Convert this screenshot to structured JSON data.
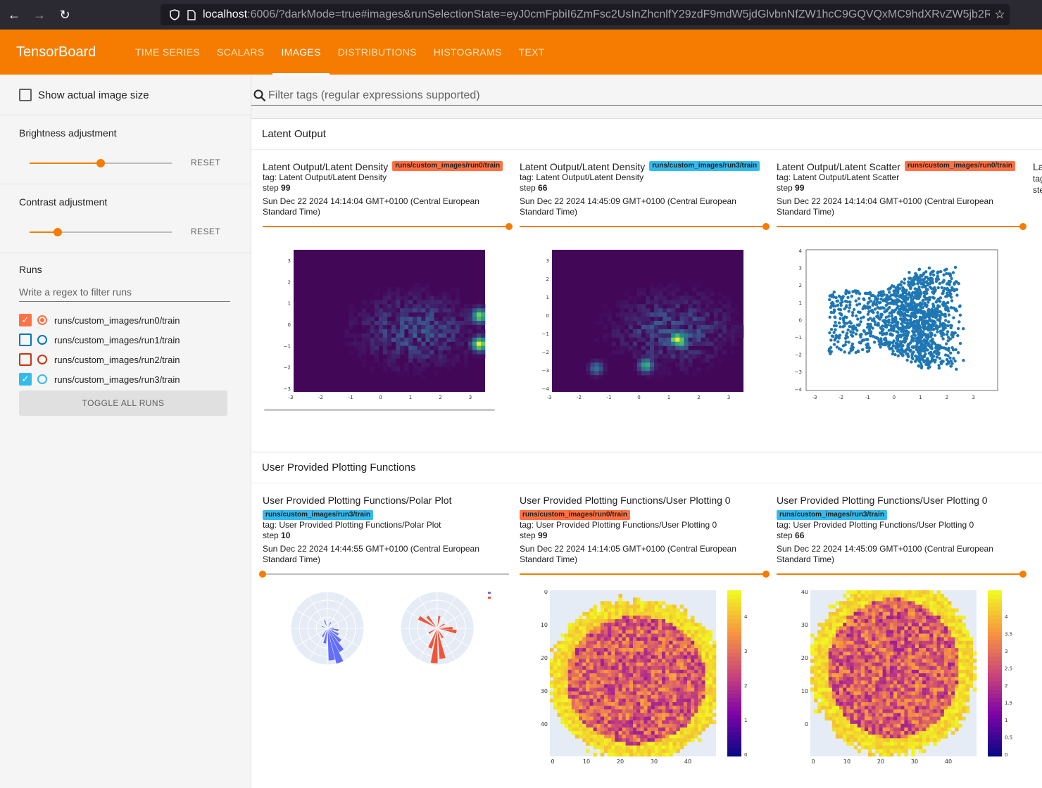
{
  "browser": {
    "url_host": "localhost",
    "url_rest": ":6006/?darkMode=true#images&runSelectionState=eyJ0cmFpbiI6ZmFsc2UsInZhcnlfY29zdF9mdW5jdGlvbnNfZW1hcC9GQVQxMC9hdXRvZW5jb2Rlci9"
  },
  "header": {
    "brand": "TensorBoard",
    "tabs": [
      "TIME SERIES",
      "SCALARS",
      "IMAGES",
      "DISTRIBUTIONS",
      "HISTOGRAMS",
      "TEXT"
    ],
    "active_tab": "IMAGES"
  },
  "sidebar": {
    "show_actual_size": "Show actual image size",
    "brightness": {
      "title": "Brightness adjustment",
      "reset": "RESET",
      "value": 0.5
    },
    "contrast": {
      "title": "Contrast adjustment",
      "reset": "RESET",
      "value": 0.2
    },
    "runs": {
      "title": "Runs",
      "filter_placeholder": "Write a regex to filter runs",
      "items": [
        {
          "name": "runs/custom_images/run0/train",
          "checked": true,
          "color": "#ff7043",
          "selected": true
        },
        {
          "name": "runs/custom_images/run1/train",
          "checked": false,
          "color": "#0077bb",
          "selected": false
        },
        {
          "name": "runs/custom_images/run2/train",
          "checked": false,
          "color": "#cc3311",
          "selected": false
        },
        {
          "name": "runs/custom_images/run3/train",
          "checked": true,
          "color": "#33bbee",
          "selected": false
        }
      ],
      "toggle_all": "TOGGLE ALL RUNS"
    }
  },
  "main": {
    "filter_placeholder": "Filter tags (regular expressions supported)",
    "groups": [
      {
        "title": "Latent Output",
        "cards": [
          {
            "title": "Latent Output/Latent Density",
            "run": "runs/custom_images/run0/train",
            "run_color": "#ff7043",
            "tag": "tag: Latent Output/Latent Density",
            "step_label": "step",
            "step": "99",
            "ts1": "Sun Dec 22 2024 14:14:04 GMT+0100 (Central European",
            "ts2": "Standard Time)",
            "slider": 1.0
          },
          {
            "title": "Latent Output/Latent Density",
            "run": "runs/custom_images/run3/train",
            "run_color": "#33bbee",
            "tag": "tag: Latent Output/Latent Density",
            "step_label": "step",
            "step": "66",
            "ts1": "Sun Dec 22 2024 14:45:09 GMT+0100 (Central European",
            "ts2": "Standard Time)",
            "slider": 1.0
          },
          {
            "title": "Latent Output/Latent Scatter",
            "run": "runs/custom_images/run0/train",
            "run_color": "#ff7043",
            "tag": "tag: Latent Output/Latent Scatter",
            "step_label": "step",
            "step": "99",
            "ts1": "Sun Dec 22 2024 14:14:04 GMT+0100 (Central European",
            "ts2": "Standard Time)",
            "slider": 1.0
          }
        ]
      },
      {
        "title": "User Provided Plotting Functions",
        "cards": [
          {
            "title": "User Provided Plotting Functions/Polar Plot",
            "run": "runs/custom_images/run3/train",
            "run_color": "#33bbee",
            "tag": "tag: User Provided Plotting Functions/Polar Plot",
            "step_label": "step",
            "step": "10",
            "ts1": "Sun Dec 22 2024 14:44:55 GMT+0100 (Central European",
            "ts2": "Standard Time)",
            "slider": 0.0
          },
          {
            "title": "User Provided Plotting Functions/User Plotting 0",
            "run": "runs/custom_images/run0/train",
            "run_color": "#ff7043",
            "tag": "tag: User Provided Plotting Functions/User Plotting 0",
            "step_label": "step",
            "step": "99",
            "ts1": "Sun Dec 22 2024 14:14:05 GMT+0100 (Central European",
            "ts2": "Standard Time)",
            "slider": 1.0
          },
          {
            "title": "User Provided Plotting Functions/User Plotting 0",
            "run": "runs/custom_images/run3/train",
            "run_color": "#33bbee",
            "tag": "tag: User Provided Plotting Functions/User Plotting 0",
            "step_label": "step",
            "step": "66",
            "ts1": "Sun Dec 22 2024 14:45:09 GMT+0100 (Central European",
            "ts2": "Standard Time)",
            "slider": 1.0
          }
        ]
      }
    ],
    "density_ticks_x": [
      "-3",
      "-2",
      "-1",
      "0",
      "1",
      "2",
      "3"
    ],
    "density_ticks_y1": [
      "3",
      "2",
      "1",
      "0",
      "−1",
      "−2",
      "−3"
    ],
    "density_ticks_y2": [
      "3",
      "2",
      "1",
      "0",
      "−1",
      "−2",
      "−3",
      "−4"
    ],
    "scatter_ticks_y": [
      "4",
      "3",
      "2",
      "1",
      "0",
      "−1",
      "−2",
      "−3",
      "−4"
    ],
    "heat_ticks_x": [
      "0",
      "10",
      "20",
      "30",
      "40"
    ],
    "heat1_ticks_y": [
      "0",
      "10",
      "20",
      "30",
      "40"
    ],
    "heat1_cbar": [
      "4",
      "3",
      "2",
      "1",
      "0"
    ],
    "heat2_ticks_y": [
      "40",
      "30",
      "20",
      "10",
      "0"
    ],
    "heat2_cbar": [
      "4",
      "3.5",
      "3",
      "2.5",
      "2",
      "1.5",
      "1",
      "0.5",
      "0"
    ]
  }
}
